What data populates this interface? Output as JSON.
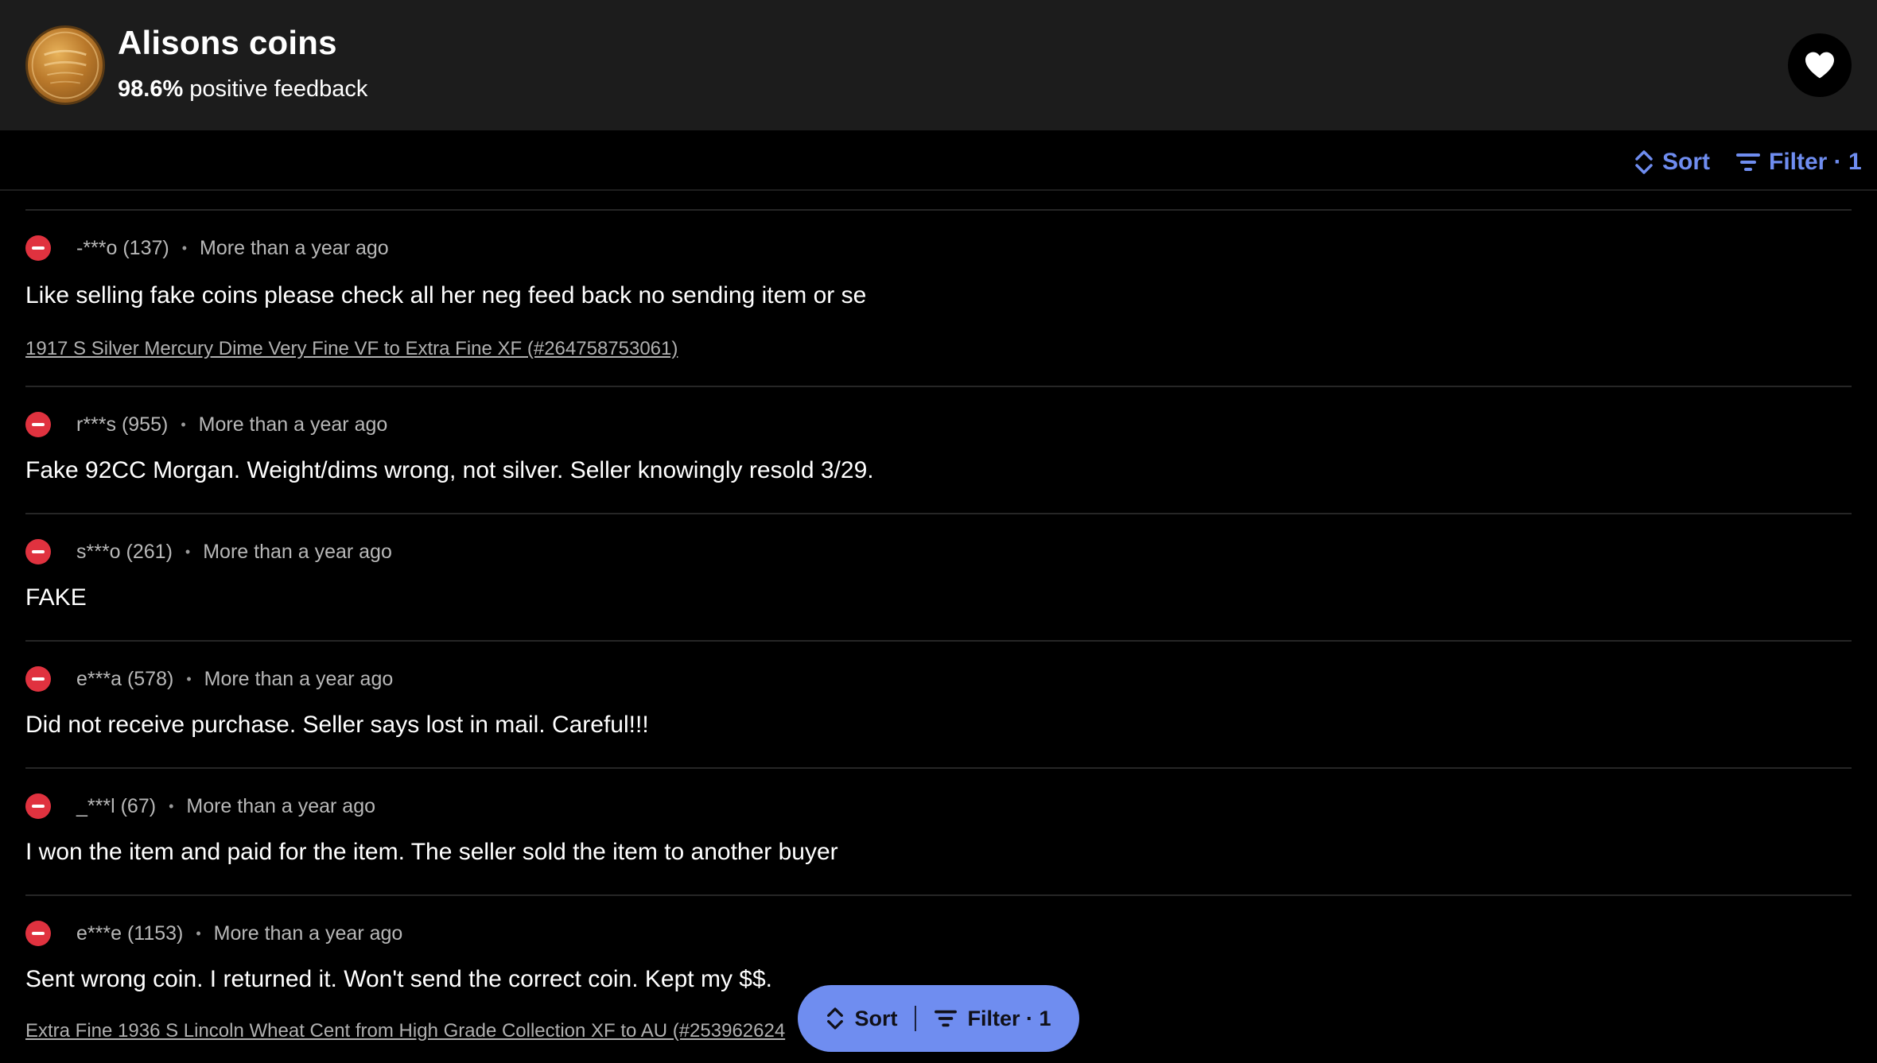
{
  "header": {
    "seller_name": "Alisons coins",
    "feedback_percent": "98.6%",
    "feedback_suffix": "positive feedback"
  },
  "toolbar": {
    "sort_label": "Sort",
    "filter_label": "Filter · 1"
  },
  "feedback": [
    {
      "user": "-***o (137)",
      "time": "More than a year ago",
      "comment": "Like selling fake coins please check all her neg feed back no sending item or se",
      "item": "1917 S Silver Mercury Dime Very Fine VF to Extra Fine XF (#264758753061)"
    },
    {
      "user": "r***s (955)",
      "time": "More than a year ago",
      "comment": "Fake 92CC Morgan. Weight/dims wrong, not silver. Seller knowingly resold 3/29."
    },
    {
      "user": "s***o (261)",
      "time": "More than a year ago",
      "comment": "FAKE"
    },
    {
      "user": "e***a (578)",
      "time": "More than a year ago",
      "comment": "Did not receive purchase. Seller says lost in mail. Careful!!!"
    },
    {
      "user": "_***l (67)",
      "time": "More than a year ago",
      "comment": "I won the item and paid for the item. The seller sold the item to another buyer"
    },
    {
      "user": "e***e (1153)",
      "time": "More than a year ago",
      "comment": "Sent wrong coin. I returned it. Won't send the correct coin. Kept my $$.",
      "item": "Extra Fine 1936 S Lincoln Wheat Cent from High Grade Collection XF to AU (#253962624"
    }
  ],
  "floating_bar": {
    "sort_label": "Sort",
    "filter_label": "Filter · 1"
  },
  "colors": {
    "accent": "#6f8df0",
    "negative": "#e0323f",
    "header_bg": "#1c1c1c"
  }
}
